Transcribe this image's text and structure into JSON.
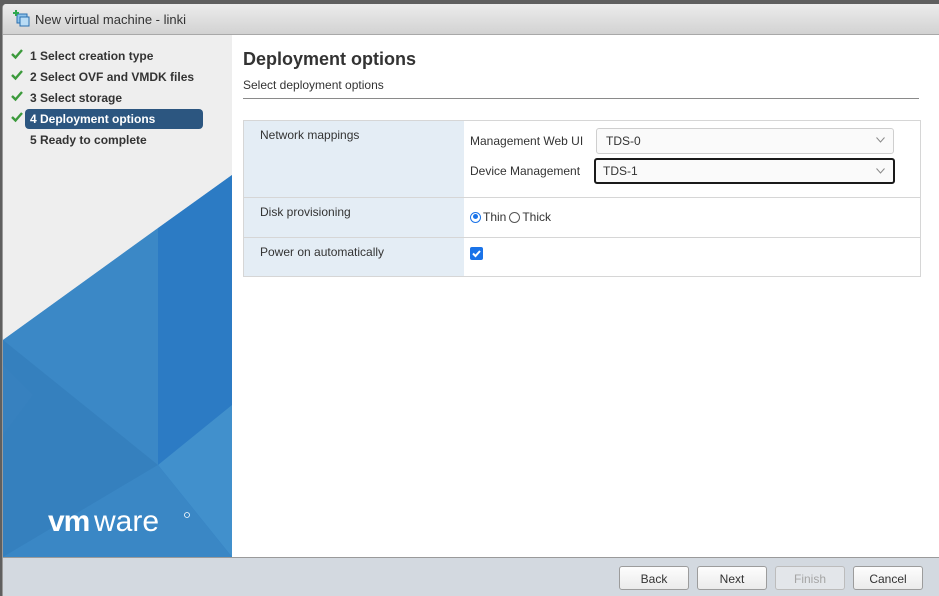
{
  "window": {
    "title": "New virtual machine - linki",
    "icon": "new-vm-icon"
  },
  "sidebar": {
    "steps": [
      {
        "label": "1  Select creation type",
        "completed": true,
        "active": false
      },
      {
        "label": "2  Select OVF and VMDK files",
        "completed": true,
        "active": false
      },
      {
        "label": "3  Select storage",
        "completed": true,
        "active": false
      },
      {
        "label": "4 Deployment options",
        "completed": true,
        "active": true
      },
      {
        "label": "5 Ready to complete",
        "completed": false,
        "active": false
      }
    ],
    "brand": "vmware",
    "check_color": "#3c9a3c",
    "active_color": "#2c5680"
  },
  "main": {
    "title": "Deployment options",
    "subtitle": "Select deployment options",
    "options": {
      "network_mappings": {
        "label": "Network mappings",
        "mappings": [
          {
            "name": "Management Web UI",
            "value": "TDS-0",
            "focused": false
          },
          {
            "name": "Device Management",
            "value": "TDS-1",
            "focused": true
          }
        ]
      },
      "disk_provisioning": {
        "label": "Disk provisioning",
        "choices": [
          {
            "label": "Thin",
            "selected": true
          },
          {
            "label": "Thick",
            "selected": false
          }
        ]
      },
      "power_on": {
        "label": "Power on automatically",
        "checked": true
      }
    }
  },
  "footer": {
    "back_label": "Back",
    "next_label": "Next",
    "finish_label": "Finish",
    "finish_disabled": true,
    "cancel_label": "Cancel"
  }
}
